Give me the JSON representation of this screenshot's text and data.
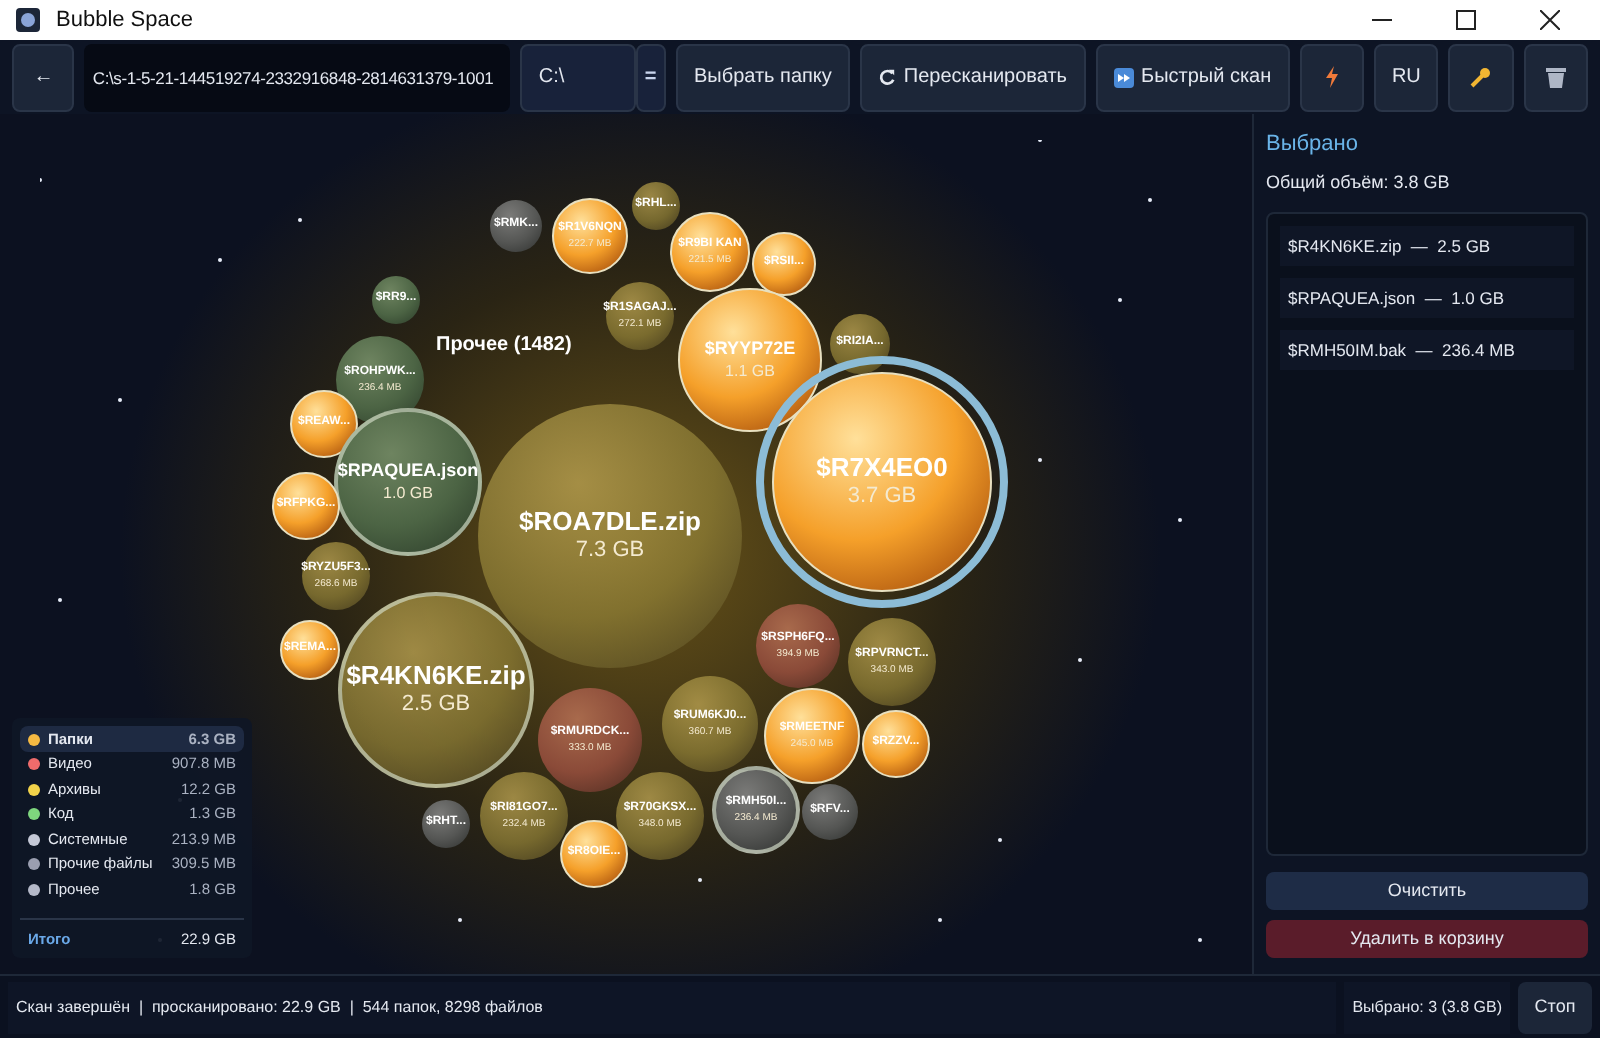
{
  "window": {
    "title": "Bubble Space"
  },
  "toolbar": {
    "back": "←",
    "path": "C:\\s-1-5-21-144519274-2332916848-2814631379-1001",
    "drive": "C:\\",
    "drive_toggle": "=",
    "buttons": [
      {
        "kind": "text",
        "label": "Выбрать папку"
      },
      {
        "kind": "rescan",
        "label": "Пересканировать"
      },
      {
        "kind": "fast",
        "label": "Быстрый скан"
      },
      {
        "kind": "bolt"
      },
      {
        "kind": "text",
        "label": "RU"
      },
      {
        "kind": "key"
      },
      {
        "kind": "trash"
      }
    ]
  },
  "canvas": {
    "group_label": "Прочее (1482)",
    "bubbles": [
      {
        "name": "$RHL...",
        "kind": "archive",
        "selected": false,
        "hovered": false
      },
      {
        "name": "$RMK...",
        "kind": "other",
        "selected": false,
        "hovered": false
      },
      {
        "name": "$R1V6NQN",
        "size": "222.7 MB",
        "kind": "folder",
        "selected": false,
        "hovered": false
      },
      {
        "name": "$R9BI KAN",
        "size": "221.5 MB",
        "kind": "folder",
        "selected": false,
        "hovered": false
      },
      {
        "name": "$RSII...",
        "kind": "folder",
        "selected": false,
        "hovered": false
      },
      {
        "name": "$RR9...",
        "kind": "code",
        "selected": false,
        "hovered": false
      },
      {
        "name": "$R1SAGAJ...",
        "size": "272.1 MB",
        "kind": "archive",
        "selected": false,
        "hovered": false
      },
      {
        "name": "$RI2IA...",
        "kind": "archive",
        "selected": false,
        "hovered": false
      },
      {
        "name": "$RYYP72E",
        "size": "1.1 GB",
        "kind": "folder",
        "selected": false,
        "hovered": false
      },
      {
        "name": "$ROHPWK...",
        "size": "236.4 MB",
        "kind": "code",
        "selected": false,
        "hovered": false
      },
      {
        "name": "$REAW...",
        "kind": "folder",
        "selected": false,
        "hovered": false
      },
      {
        "name": "$RPAQUEA.json",
        "size": "1.0 GB",
        "kind": "code",
        "selected": true,
        "hovered": false
      },
      {
        "name": "$R7X4EO0",
        "size": "3.7 GB",
        "kind": "folder",
        "selected": false,
        "hovered": true
      },
      {
        "name": "$RFPKG...",
        "kind": "folder",
        "selected": false,
        "hovered": false
      },
      {
        "name": "$ROA7DLE.zip",
        "size": "7.3 GB",
        "kind": "archive",
        "selected": false,
        "hovered": false
      },
      {
        "name": "$RYZU5F3...",
        "size": "268.6 MB",
        "kind": "archive",
        "selected": false,
        "hovered": false
      },
      {
        "name": "$REMA...",
        "kind": "folder",
        "selected": false,
        "hovered": false
      },
      {
        "name": "$RSPH6FQ...",
        "size": "394.9 MB",
        "kind": "video",
        "selected": false,
        "hovered": false
      },
      {
        "name": "$RPVRNCT...",
        "size": "343.0 MB",
        "kind": "archive",
        "selected": false,
        "hovered": false
      },
      {
        "name": "$R4KN6KE.zip",
        "size": "2.5 GB",
        "kind": "archive",
        "selected": true,
        "hovered": false
      },
      {
        "name": "$RMURDCK...",
        "size": "333.0 MB",
        "kind": "video",
        "selected": false,
        "hovered": false
      },
      {
        "name": "$RUM6KJ0...",
        "size": "360.7 MB",
        "kind": "archive",
        "selected": false,
        "hovered": false
      },
      {
        "name": "$RMEETNF",
        "size": "245.0 MB",
        "kind": "folder",
        "selected": false,
        "hovered": false
      },
      {
        "name": "$RZZV...",
        "kind": "folder",
        "selected": false,
        "hovered": false
      },
      {
        "name": "$RHT...",
        "kind": "other",
        "selected": false,
        "hovered": false
      },
      {
        "name": "$RI81GO7...",
        "size": "232.4 MB",
        "kind": "archive",
        "selected": false,
        "hovered": false
      },
      {
        "name": "$R70GKSX...",
        "size": "348.0 MB",
        "kind": "archive",
        "selected": false,
        "hovered": false
      },
      {
        "name": "$RMH50I...",
        "size": "236.4 MB",
        "kind": "other",
        "selected": true,
        "hovered": false
      },
      {
        "name": "$RFV...",
        "kind": "other",
        "selected": false,
        "hovered": false
      },
      {
        "name": "$R8OIE...",
        "kind": "folder",
        "selected": false,
        "hovered": false
      }
    ]
  },
  "legend": {
    "items": [
      {
        "label": "Папки",
        "value": "6.3 GB",
        "color": "#f5b942",
        "selected": true
      },
      {
        "label": "Видео",
        "value": "907.8 MB",
        "color": "#ee6b6b",
        "selected": false
      },
      {
        "label": "Архивы",
        "value": "12.2 GB",
        "color": "#f2d24a",
        "selected": false
      },
      {
        "label": "Код",
        "value": "1.3 GB",
        "color": "#7ed67e",
        "selected": false
      },
      {
        "label": "Системные",
        "value": "213.9 MB",
        "color": "#c4c8d6",
        "selected": false
      },
      {
        "label": "Прочие файлы",
        "value": "309.5 MB",
        "color": "#9a9eb0",
        "selected": false
      },
      {
        "label": "Прочее",
        "value": "1.8 GB",
        "color": "#b4b8c8",
        "selected": false
      }
    ],
    "total_label": "Итого",
    "total_value": "22.9 GB"
  },
  "selection_panel": {
    "title": "Выбрано",
    "total": "Общий объём: 3.8 GB",
    "items": [
      "$R4KN6KE.zip  —  2.5 GB",
      "$RPAQUEA.json  —  1.0 GB",
      "$RMH50IM.bak  —  236.4 MB"
    ],
    "clear_button": "Очистить",
    "delete_button": "Удалить в корзину"
  },
  "status_bar": {
    "text": "Скан завершён  |  просканировано: 22.9 GB  |  544 папок, 8298 файлов",
    "selected": "Выбрано: 3 (3.8 GB)",
    "stop_button": "Стоп"
  }
}
